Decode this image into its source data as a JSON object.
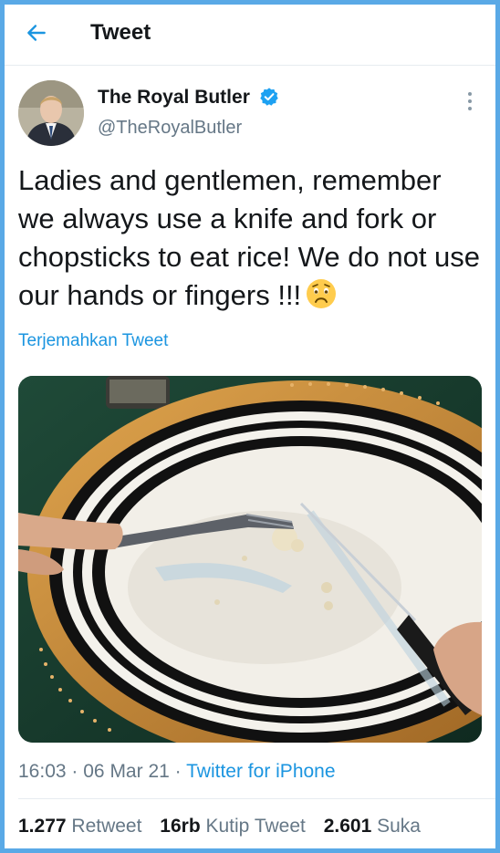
{
  "header": {
    "title": "Tweet"
  },
  "author": {
    "name": "The Royal Butler",
    "handle": "@TheRoyalButler",
    "verified": true
  },
  "tweet": {
    "text": "Ladies and gentlemen, remember we always use a knife and fork or chopsticks to eat rice! We do not use our hands or fingers !!!",
    "emoji": "worried-face",
    "translate_label": "Terjemahkan Tweet"
  },
  "meta": {
    "time": "16:03",
    "date": "06 Mar 21",
    "separator": "·",
    "source": "Twitter for iPhone"
  },
  "stats": {
    "retweets_count": "1.277",
    "retweets_label": "Retweet",
    "quotes_count": "16rb",
    "quotes_label": "Kutip Tweet",
    "likes_count": "2.601",
    "likes_label": "Suka"
  },
  "colors": {
    "accent": "#1b95e0",
    "frame_border": "#5aa9e6",
    "text_primary": "#14171a",
    "text_secondary": "#657786"
  }
}
